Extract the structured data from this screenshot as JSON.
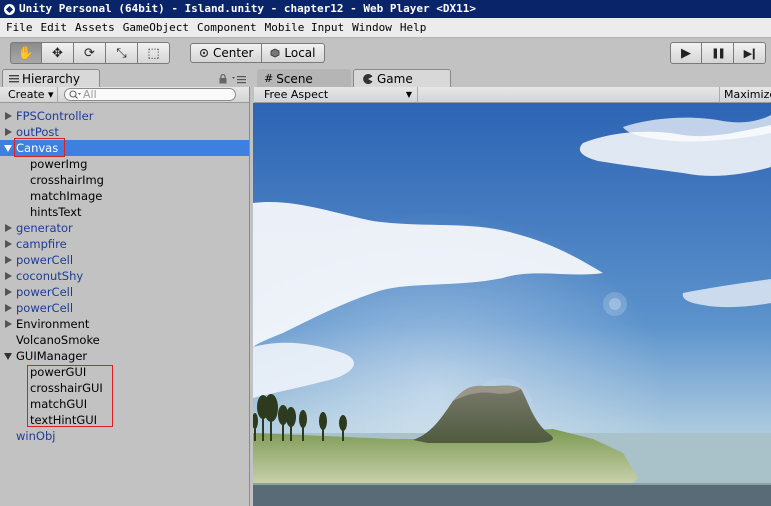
{
  "window": {
    "title": "Unity Personal (64bit) - Island.unity - chapter12 - Web Player <DX11>"
  },
  "menu": [
    "File",
    "Edit",
    "Assets",
    "GameObject",
    "Component",
    "Mobile Input",
    "Window",
    "Help"
  ],
  "toolbar": {
    "tools": [
      {
        "name": "hand-tool",
        "icon": "hand-icon",
        "glyph": "✋"
      },
      {
        "name": "move-tool",
        "icon": "move-icon",
        "glyph": "✥"
      },
      {
        "name": "rotate-tool",
        "icon": "rotate-icon",
        "glyph": "⟳"
      },
      {
        "name": "scale-tool",
        "icon": "scale-icon",
        "glyph": "⤡"
      },
      {
        "name": "rect-tool",
        "icon": "rect-icon",
        "glyph": "⬚"
      }
    ],
    "center_label": "Center",
    "local_label": "Local",
    "play_icon": "▶",
    "pause_icon": "❚❚",
    "step_icon": "▶❙"
  },
  "hierarchy": {
    "tab_label": "Hierarchy",
    "create_label": "Create ▾",
    "search_placeholder": "All",
    "items": [
      {
        "label": "FPSController",
        "prefab": true,
        "arrow": "closed",
        "child": false
      },
      {
        "label": "outPost",
        "prefab": true,
        "arrow": "closed",
        "child": false
      },
      {
        "label": "Canvas",
        "prefab": false,
        "arrow": "open",
        "child": false,
        "selected": true
      },
      {
        "label": "powerImg",
        "prefab": false,
        "arrow": "none",
        "child": true
      },
      {
        "label": "crosshairImg",
        "prefab": false,
        "arrow": "none",
        "child": true
      },
      {
        "label": "matchImage",
        "prefab": false,
        "arrow": "none",
        "child": true
      },
      {
        "label": "hintsText",
        "prefab": false,
        "arrow": "none",
        "child": true
      },
      {
        "label": "generator",
        "prefab": true,
        "arrow": "closed",
        "child": false
      },
      {
        "label": "campfire",
        "prefab": true,
        "arrow": "closed",
        "child": false
      },
      {
        "label": "powerCell",
        "prefab": true,
        "arrow": "closed",
        "child": false
      },
      {
        "label": "coconutShy",
        "prefab": true,
        "arrow": "closed",
        "child": false
      },
      {
        "label": "powerCell",
        "prefab": true,
        "arrow": "closed",
        "child": false
      },
      {
        "label": "powerCell",
        "prefab": true,
        "arrow": "closed",
        "child": false
      },
      {
        "label": "Environment",
        "prefab": false,
        "arrow": "closed",
        "child": false
      },
      {
        "label": "VolcanoSmoke",
        "prefab": false,
        "arrow": "none",
        "child": false
      },
      {
        "label": "GUIManager",
        "prefab": false,
        "arrow": "open",
        "child": false
      },
      {
        "label": "powerGUI",
        "prefab": false,
        "arrow": "none",
        "child": true
      },
      {
        "label": "crosshairGUI",
        "prefab": false,
        "arrow": "none",
        "child": true
      },
      {
        "label": "matchGUI",
        "prefab": false,
        "arrow": "none",
        "child": true
      },
      {
        "label": "textHintGUI",
        "prefab": false,
        "arrow": "none",
        "child": true
      },
      {
        "label": "winObj",
        "prefab": true,
        "arrow": "none",
        "child": false
      }
    ]
  },
  "tabs": {
    "scene_label": "Scene",
    "game_label": "Game"
  },
  "game": {
    "aspect_label": "Free Aspect",
    "maximize_label": "Maximize"
  },
  "colors": {
    "selection": "#3d80df",
    "prefab_text": "#1e3c96",
    "highlight_box": "#e02020",
    "title_bar": "#0a246a"
  }
}
